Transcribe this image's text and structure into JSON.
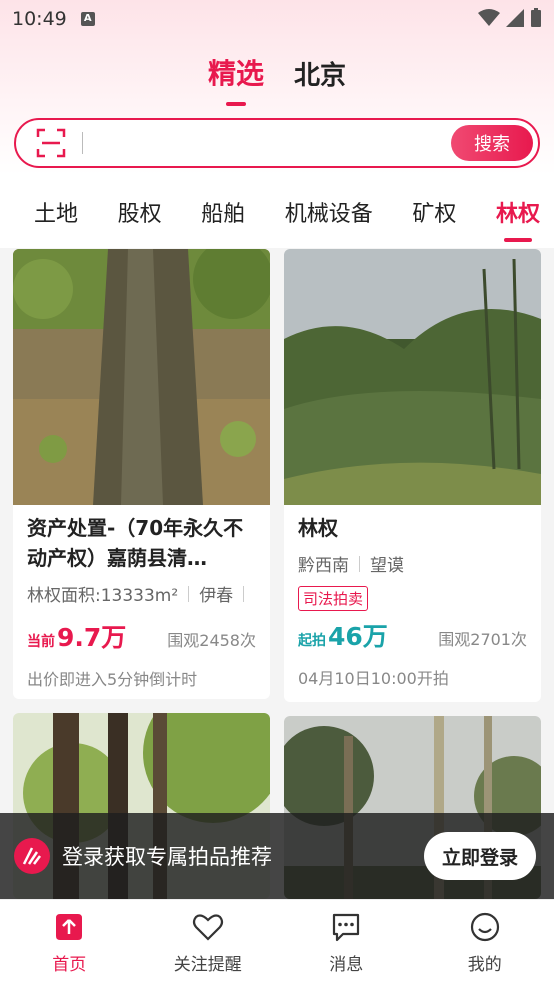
{
  "status_bar": {
    "time": "10:49",
    "notification_letter": "A"
  },
  "header": {
    "tabs": [
      {
        "label": "精选",
        "active": true
      },
      {
        "label": "北京",
        "active": false
      }
    ]
  },
  "search": {
    "placeholder": "",
    "button_label": "搜索"
  },
  "categories": [
    {
      "label": "土地",
      "active": false
    },
    {
      "label": "股权",
      "active": false
    },
    {
      "label": "船舶",
      "active": false
    },
    {
      "label": "机械设备",
      "active": false
    },
    {
      "label": "矿权",
      "active": false
    },
    {
      "label": "林权",
      "active": true
    }
  ],
  "listings": [
    {
      "title": "资产处置-（70年永久不动产权）嘉荫县清…",
      "meta": [
        "林权面积:13333m²",
        "伊春"
      ],
      "price_label": "当前",
      "price": "9.7万",
      "views": "围观2458次",
      "footer": "出价即进入5分钟倒计时"
    },
    {
      "title": "林权",
      "meta": [
        "黔西南",
        "望谟"
      ],
      "badge": "司法拍卖",
      "price_label": "起拍",
      "price": "46万",
      "views": "围观2701次",
      "footer": "04月10日10:00开拍"
    }
  ],
  "login_banner": {
    "text": "登录获取专属拍品推荐",
    "button_label": "立即登录"
  },
  "tab_bar": [
    {
      "label": "首页",
      "icon": "home-upload-icon",
      "active": true
    },
    {
      "label": "关注提醒",
      "icon": "heart-icon",
      "active": false
    },
    {
      "label": "消息",
      "icon": "message-icon",
      "active": false
    },
    {
      "label": "我的",
      "icon": "smile-icon",
      "active": false
    }
  ],
  "colors": {
    "accent": "#e8194e",
    "teal": "#1aa3a9"
  }
}
